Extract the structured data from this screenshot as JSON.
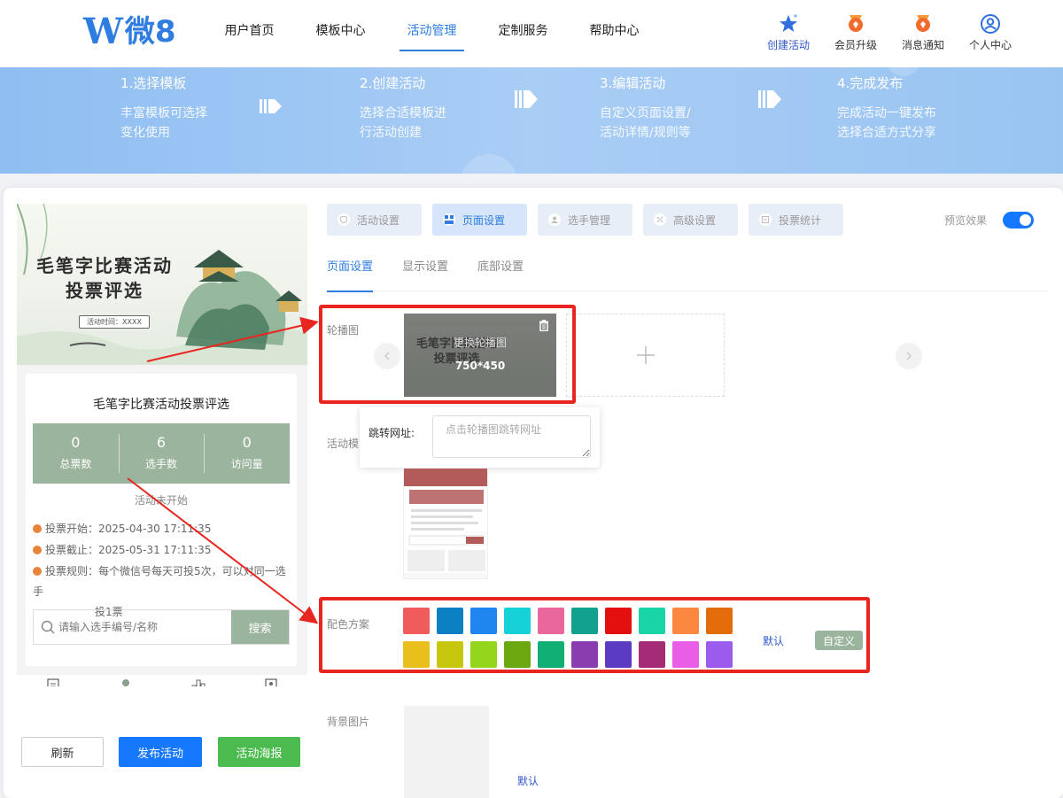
{
  "header": {
    "logo_text": "微8",
    "nav": [
      "用户首页",
      "模板中心",
      "活动管理",
      "定制服务",
      "帮助中心"
    ],
    "right_items": [
      "创建活动",
      "会员升级",
      "消息通知",
      "个人中心"
    ]
  },
  "banner": {
    "steps": [
      {
        "title": "1.选择模板",
        "line1": "丰富模板可选择",
        "line2": "变化使用"
      },
      {
        "title": "2.创建活动",
        "line1": "选择合适模板进",
        "line2": "行活动创建"
      },
      {
        "title": "3.编辑活动",
        "line1": "自定义页面设置/",
        "line2": "活动详情/规则等"
      },
      {
        "title": "4.完成发布",
        "line1": "完成活动一键发布",
        "line2": "选择合适方式分享"
      }
    ]
  },
  "preview": {
    "poster_title_line1": "毛笔字比赛活动",
    "poster_title_line2": "投票评选",
    "poster_date": "活动时间：XXXX",
    "title": "毛笔字比赛活动投票评选",
    "stats": [
      {
        "value": "0",
        "label": "总票数"
      },
      {
        "value": "6",
        "label": "选手数"
      },
      {
        "value": "0",
        "label": "访问量"
      }
    ],
    "status": "活动未开始",
    "vote_start": "投票开始：2025-04-30 17:11:35",
    "vote_end": "投票截止：2025-05-31 17:11:35",
    "vote_rule_line1": "投票规则：每个微信号每天可投5次，可以对同一选手",
    "vote_rule_line2": "投1票",
    "search_placeholder": "请输入选手编号/名称",
    "search_button": "搜索",
    "tabbar": [
      "介绍",
      "投票",
      "排行",
      "报名"
    ]
  },
  "actions": {
    "refresh": "刷新",
    "publish": "发布活动",
    "poster": "活动海报"
  },
  "editor": {
    "tabs": [
      "活动设置",
      "页面设置",
      "选手管理",
      "高级设置",
      "投票统计"
    ],
    "preview_label": "预览效果",
    "preview_enabled": true,
    "subtabs": [
      "页面设置",
      "显示设置",
      "底部设置"
    ],
    "carousel_label": "轮播图",
    "carousel_hint": "更换轮播图",
    "carousel_size": "750*450",
    "url_label": "跳转网址:",
    "url_placeholder": "点击轮播图跳转网址",
    "template_label": "活动模",
    "color_label": "配色方案",
    "colors_row1": [
      "#f05b5b",
      "#0b80c2",
      "#1e86ee",
      "#14d2d8",
      "#e9679a",
      "#12a08f",
      "#e30f0f",
      "#19d4a6",
      "#fb8740",
      "#e26b0a"
    ],
    "colors_row2": [
      "#e8bf1c",
      "#c7c80e",
      "#93d61c",
      "#6ba80f",
      "#12af74",
      "#8a3dae",
      "#5a3bc2",
      "#a52b77",
      "#e85ee7",
      "#9b5cee"
    ],
    "color_default": "默认",
    "color_custom": "自定义",
    "bg_label": "背景图片",
    "bg_default": "默认"
  }
}
